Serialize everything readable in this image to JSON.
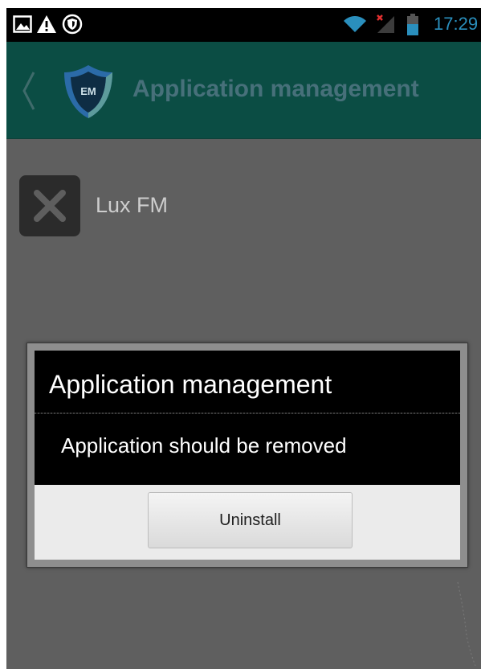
{
  "status_bar": {
    "time": "17:29",
    "icons": [
      "picture-icon",
      "warning-icon",
      "shield-icon",
      "wifi-icon",
      "signal-icon",
      "battery-icon"
    ]
  },
  "action_bar": {
    "title": "Application management",
    "logo_text": "EM",
    "icons": [
      "back-chevron-icon",
      "app-logo-icon"
    ]
  },
  "app_row": {
    "app_name": "Lux FM",
    "icon": "close-x-icon"
  },
  "dialog": {
    "title": "Application management",
    "message": "Application should be removed",
    "button_label": "Uninstall"
  },
  "colors": {
    "status_bar": "#000000",
    "action_bar": "#0b4d44",
    "background": "#5f5f5f",
    "dialog_body": "#000000",
    "button_bar": "#ebebeb",
    "clock": "#2a8fbd"
  }
}
